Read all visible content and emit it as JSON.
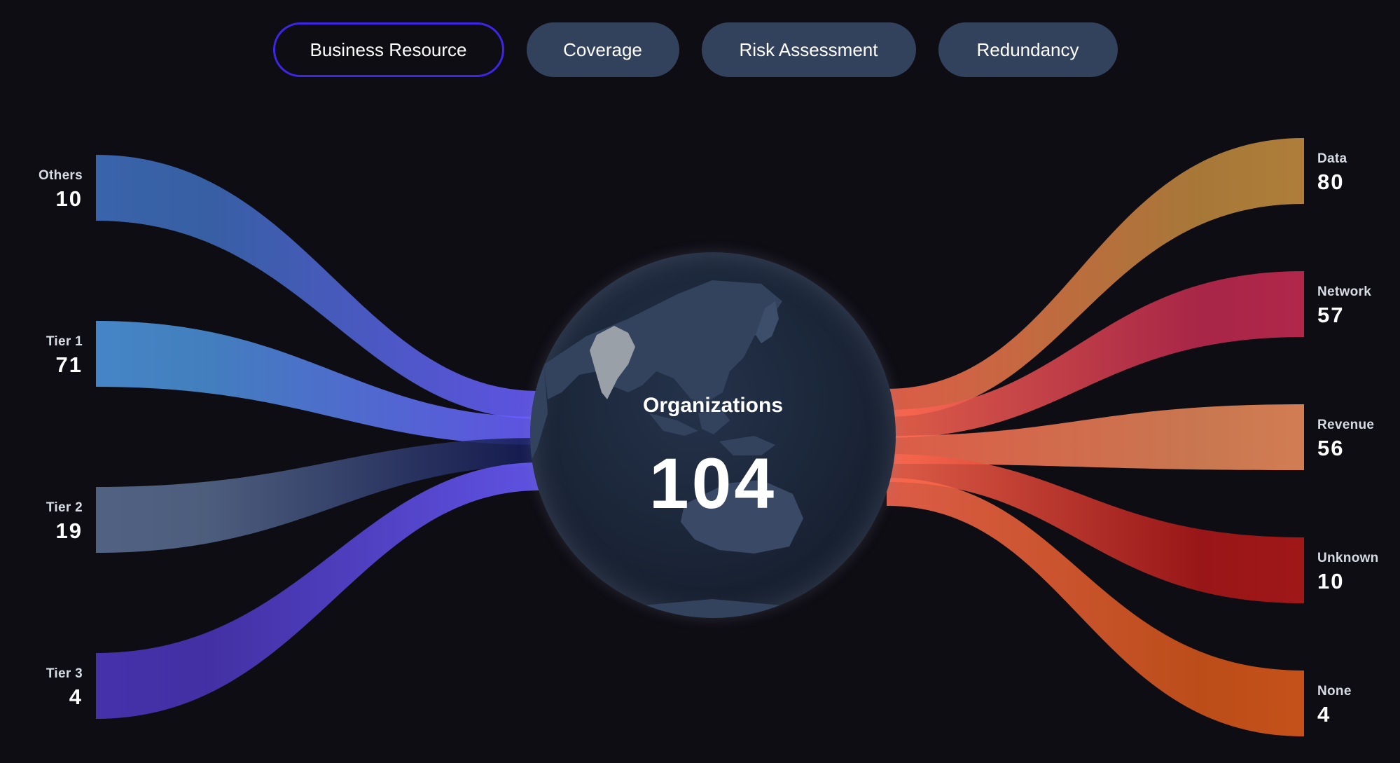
{
  "tabs": [
    {
      "label": "Business Resource",
      "active": true
    },
    {
      "label": "Coverage",
      "active": false
    },
    {
      "label": "Risk Assessment",
      "active": false
    },
    {
      "label": "Redundancy",
      "active": false
    }
  ],
  "center": {
    "title": "Organizations",
    "value": "104"
  },
  "left_nodes": [
    {
      "name": "Others",
      "value": "10",
      "color": "#3d6bb8"
    },
    {
      "name": "Tier 1",
      "value": "71",
      "color": "#4a8fd6"
    },
    {
      "name": "Tier 2",
      "value": "19",
      "color": "#56698c"
    },
    {
      "name": "Tier 3",
      "value": "4",
      "color": "#4a35b8"
    }
  ],
  "right_nodes": [
    {
      "name": "Data",
      "value": "80",
      "color": "#c08a3e"
    },
    {
      "name": "Network",
      "value": "57",
      "color": "#c22a50"
    },
    {
      "name": "Revenue",
      "value": "56",
      "color": "#e8895a"
    },
    {
      "name": "Unknown",
      "value": "10",
      "color": "#b01818"
    },
    {
      "name": "None",
      "value": "4",
      "color": "#d9581a"
    }
  ],
  "hub_color": "#6a5cff",
  "hub_color_right": "#ff6a50"
}
